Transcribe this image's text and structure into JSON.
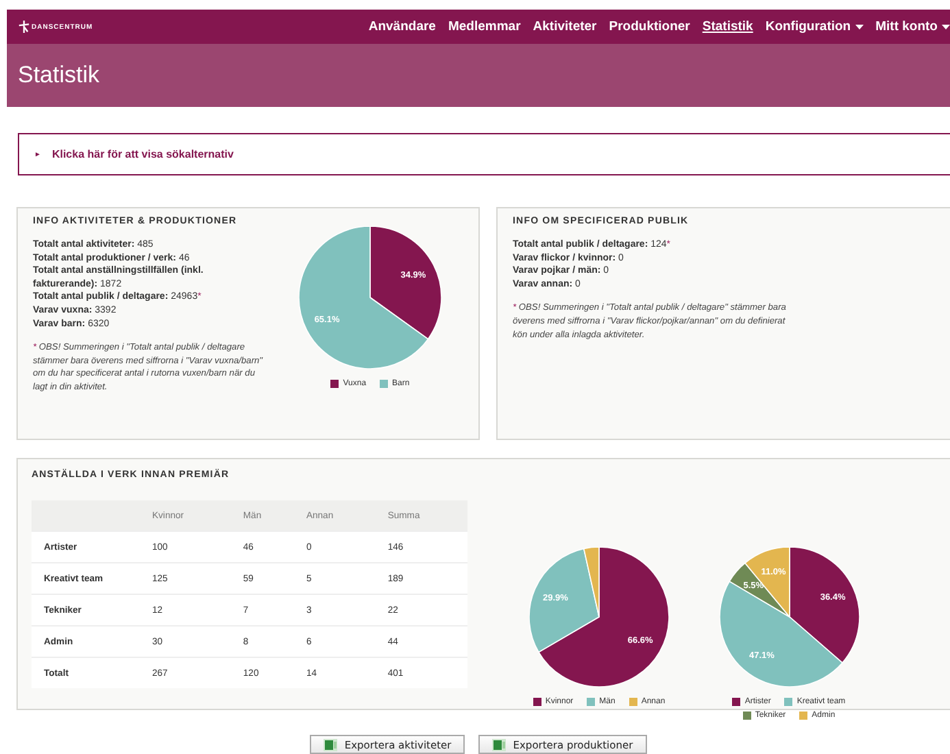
{
  "nav": {
    "logo": "DANSCENTRUM",
    "items": [
      {
        "label": "Användare",
        "selected": false,
        "dropdown": false
      },
      {
        "label": "Medlemmar",
        "selected": false,
        "dropdown": false
      },
      {
        "label": "Aktiviteter",
        "selected": false,
        "dropdown": false
      },
      {
        "label": "Produktioner",
        "selected": false,
        "dropdown": false
      },
      {
        "label": "Statistik",
        "selected": true,
        "dropdown": false
      },
      {
        "label": "Konfiguration",
        "selected": false,
        "dropdown": true
      },
      {
        "label": "Mitt konto",
        "selected": false,
        "dropdown": true
      }
    ]
  },
  "page_title": "Statistik",
  "search_toggle": {
    "icon": "►",
    "label": "Klicka här för att visa sökalternativ"
  },
  "info_panels": [
    {
      "title": "INFO AKTIVITETER & PRODUKTIONER",
      "lines": [
        {
          "text": "**Totalt antal aktiviteter:** 485"
        },
        {
          "text": "**Totalt antal produktioner / verk:** 46"
        },
        {
          "text": "**Totalt antal anställningstillfällen (inkl. fakturerande):** 1872"
        },
        {
          "text": "**Totalt antal publik / deltagare:** 24963",
          "mark": "*"
        },
        {
          "text": "**Varav vuxna:** 3392"
        },
        {
          "text": "**Varav barn:** 6320"
        }
      ],
      "note": {
        "mark": "*",
        "text": "OBS! Summeringen i \"Totalt antal publik / deltagare stämmer bara överens med siffrorna i \"Varav vuxna/barn\" om du har specificerat antal i rutorna vuxen/barn när du lagt in din aktivitet."
      },
      "chart_data": {
        "type": "pie",
        "categories": [
          "Vuxna",
          "Barn"
        ],
        "values": [
          34.9,
          65.1
        ],
        "colors": [
          "#84164f",
          "#80c1bd"
        ],
        "value_labels": [
          "34.9%",
          "65.1%"
        ],
        "legend": "bottom"
      }
    },
    {
      "title": "INFO OM SPECIFICERAD PUBLIK",
      "lines": [
        {
          "text": "**Totalt antal publik / deltagare:** 124",
          "mark": "*"
        },
        {
          "text": "**Varav flickor / kvinnor:** 0"
        },
        {
          "text": "**Varav pojkar / män:** 0"
        },
        {
          "text": "**Varav annan:** 0"
        }
      ],
      "note": {
        "mark": "*",
        "text": "OBS! Summeringen i \"Totalt antal publik / deltagare\" stämmer bara överens med siffrorna i \"Varav flickor/pojkar/annan\" om du definierat kön under alla inlagda aktiviteter."
      }
    }
  ],
  "staff_panel": {
    "title": "ANSTÄLLDA I VERK INNAN PREMIÄR",
    "table": {
      "columns": [
        "Kvinnor",
        "Män",
        "Annan",
        "Summa"
      ],
      "rows": [
        {
          "label": "Artister",
          "cells": [
            "100",
            "46",
            "0",
            "146"
          ]
        },
        {
          "label": "Kreativt team",
          "cells": [
            "125",
            "59",
            "5",
            "189"
          ]
        },
        {
          "label": "Tekniker",
          "cells": [
            "12",
            "7",
            "3",
            "22"
          ]
        },
        {
          "label": "Admin",
          "cells": [
            "30",
            "8",
            "6",
            "44"
          ]
        },
        {
          "label": "Totalt",
          "cells": [
            "267",
            "120",
            "14",
            "401"
          ]
        }
      ]
    },
    "charts": [
      {
        "chart_data": {
          "type": "pie",
          "categories": [
            "Kvinnor",
            "Män",
            "Annan"
          ],
          "values": [
            66.6,
            29.9,
            3.5
          ],
          "colors": [
            "#84164f",
            "#80c1bd",
            "#e3b64f"
          ],
          "value_labels": [
            "66.6%",
            "29.9%",
            null
          ],
          "legend": "bottom"
        }
      },
      {
        "chart_data": {
          "type": "pie",
          "categories": [
            "Artister",
            "Kreativt team",
            "Tekniker",
            "Admin"
          ],
          "values": [
            36.4,
            47.1,
            5.5,
            11.0
          ],
          "colors": [
            "#84164f",
            "#80c1bd",
            "#6f8a55",
            "#e3b64f"
          ],
          "value_labels": [
            "36.4%",
            "47.1%",
            "5.5%",
            "11.0%"
          ],
          "legend": "bottom"
        }
      }
    ]
  },
  "export_buttons": [
    "Exportera aktiviteter",
    "Exportera produktioner"
  ]
}
